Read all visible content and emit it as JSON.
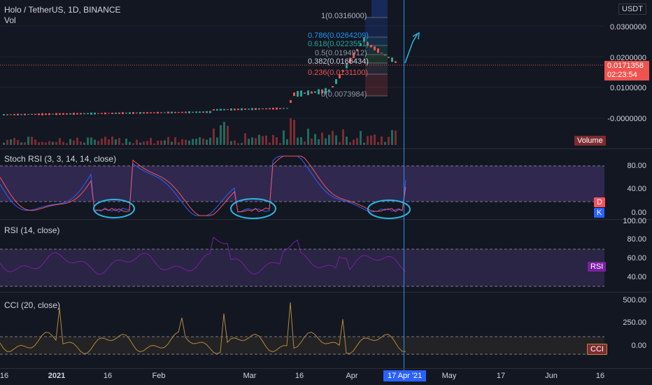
{
  "header": {
    "symbol": "Holo / TetherUS, 1D, BINANCE",
    "vol_label": "Vol",
    "currency": "USDT"
  },
  "price_axis": {
    "ticks": [
      "0.0300000",
      "0.0200000",
      "0.0100000",
      "-0.0000000"
    ],
    "current_price": "0.0171358",
    "countdown": "02:23:54",
    "volume_badge": "Volume"
  },
  "fibonacci": [
    {
      "text": "1(0.0316000)",
      "color": "#b2b5be"
    },
    {
      "text": "0.786(0.0264209)",
      "color": "#2196f3"
    },
    {
      "text": "0.618(0.0223551)",
      "color": "#26a69a"
    },
    {
      "text": "0.5(0.0194912)",
      "color": "#9598a1"
    },
    {
      "text": "0.382(0.0166434)",
      "color": "#d1d4dc"
    },
    {
      "text": "0.236(0.0131100)",
      "color": "#ef5350"
    },
    {
      "text": "0(0.0073984)",
      "color": "#9598a1"
    }
  ],
  "stoch_rsi": {
    "title": "Stoch RSI (3, 3, 14, 14, close)",
    "ticks": [
      "80.00",
      "40.00",
      "0.00"
    ],
    "badge_d": "D",
    "badge_k": "K"
  },
  "rsi": {
    "title": "RSI (14, close)",
    "ticks": [
      "100.00",
      "80.00",
      "60.00",
      "40.00"
    ],
    "badge": "RSI"
  },
  "cci": {
    "title": "CCI (20, close)",
    "ticks": [
      "500.00",
      "250.00",
      "0.00"
    ],
    "badge": "CCI"
  },
  "time_axis": {
    "labels": [
      "16",
      "2021",
      "16",
      "Feb",
      "Mar",
      "16",
      "Apr",
      "May",
      "17",
      "Jun",
      "16"
    ],
    "crosshair_label": "17 Apr '21"
  },
  "colors": {
    "background": "#131722",
    "up": "#26a69a",
    "down": "#ef5350",
    "stoch_band": "#7e57c2",
    "rsi_line": "#7b1fa2",
    "cci_line": "#b58a3a",
    "crosshair": "#2196f3",
    "annotation": "#2bb6e0"
  }
}
